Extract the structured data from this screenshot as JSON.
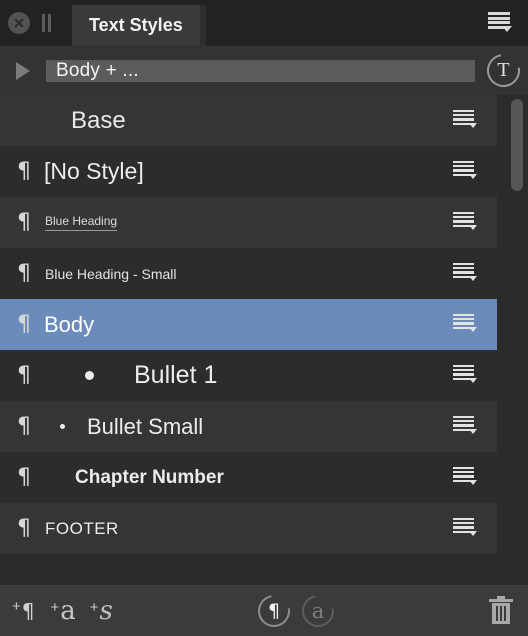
{
  "window": {
    "tab_label": "Text Styles",
    "close_icon": "close-icon",
    "pause_icon": "pause-icon",
    "menu_icon": "hamburger-menu-icon"
  },
  "stylebar": {
    "disclosure_icon": "disclosure-triangle-icon",
    "current_style": "Body + ...",
    "current_style_placeholder": "Body + ...",
    "revert_icon": "revert-text-style-icon",
    "revert_glyph": "T"
  },
  "list": {
    "rows": [
      {
        "label": "Base",
        "kind": "group",
        "pilcrow": "",
        "menu_icon": "row-menu-icon",
        "selected": false
      },
      {
        "label": "[No Style]",
        "kind": "nostyle",
        "pilcrow": "¶",
        "menu_icon": "row-menu-icon",
        "selected": false
      },
      {
        "label": "Blue Heading",
        "kind": "blueheading",
        "pilcrow": "¶",
        "menu_icon": "row-menu-icon",
        "selected": false
      },
      {
        "label": "Blue Heading - Small",
        "kind": "bluesmall",
        "pilcrow": "¶",
        "menu_icon": "row-menu-icon",
        "selected": false
      },
      {
        "label": "Body",
        "kind": "body",
        "pilcrow": "¶",
        "menu_icon": "row-menu-icon",
        "selected": true
      },
      {
        "label": "Bullet 1",
        "kind": "bullet1",
        "pilcrow": "¶",
        "menu_icon": "row-menu-icon",
        "selected": false
      },
      {
        "label": "Bullet Small",
        "kind": "bulletsm",
        "pilcrow": "¶",
        "menu_icon": "row-menu-icon",
        "selected": false
      },
      {
        "label": "Chapter Number",
        "kind": "chapter",
        "pilcrow": "¶",
        "menu_icon": "row-menu-icon",
        "selected": false
      },
      {
        "label": "FOOTER",
        "kind": "footer",
        "pilcrow": "¶",
        "menu_icon": "row-menu-icon",
        "selected": false
      }
    ],
    "scrollbar": "vertical-scrollbar"
  },
  "toolbar": {
    "add_paragraph_style": {
      "plus": "+",
      "glyph": "¶",
      "name": "add-paragraph-style-button"
    },
    "add_character_style": {
      "plus": "+",
      "glyph": "a",
      "name": "add-character-style-button"
    },
    "add_style_group": {
      "plus": "+",
      "glyph": "s",
      "name": "add-style-group-button"
    },
    "reset_paragraph_style": {
      "glyph": "¶",
      "name": "reset-paragraph-style-button",
      "enabled": true
    },
    "reset_character_style": {
      "glyph": "a",
      "name": "reset-character-style-button",
      "enabled": false
    },
    "delete_style": {
      "name": "delete-style-button"
    }
  },
  "colors": {
    "panel_bg": "#333333",
    "titlebar_bg": "#222222",
    "tab_bg": "#3a3a3a",
    "row_odd": "#353535",
    "row_even": "#2c2c2c",
    "selection": "#6b8cba",
    "toolbar_bg": "#3b3b3b",
    "text": "#ececec"
  }
}
